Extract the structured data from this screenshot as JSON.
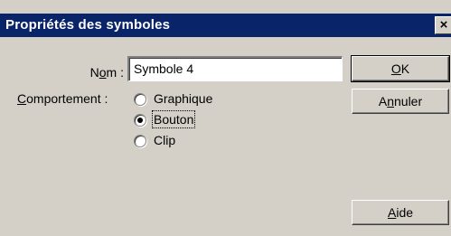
{
  "dialog": {
    "title": "Propriétés des symboles",
    "close_glyph": "×"
  },
  "name_field": {
    "label_pre": "N",
    "label_acc": "o",
    "label_post": "m :",
    "value": "Symbole 4"
  },
  "behavior": {
    "label_acc": "C",
    "label_post": "omportement :",
    "options": [
      {
        "label": "Graphique",
        "selected": false
      },
      {
        "label": "Bouton",
        "selected": true
      },
      {
        "label": "Clip",
        "selected": false
      }
    ]
  },
  "buttons": {
    "ok_acc": "O",
    "ok_post": "K",
    "cancel_pre": "A",
    "cancel_acc": "n",
    "cancel_post": "nuler",
    "help_acc": "A",
    "help_post": "ide"
  }
}
